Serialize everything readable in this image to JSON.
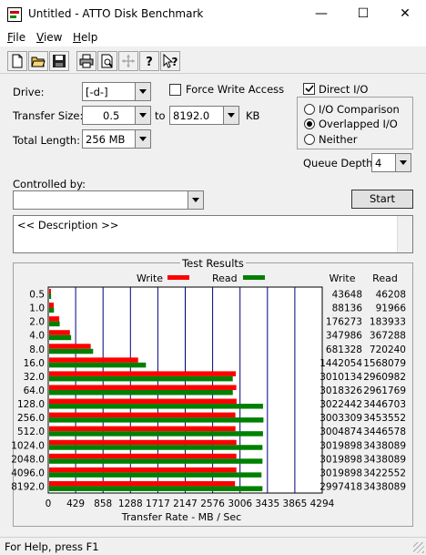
{
  "window": {
    "title": "Untitled - ATTO Disk Benchmark",
    "minimize_glyph": "—",
    "maximize_glyph": "☐",
    "close_glyph": "✕"
  },
  "menu": [
    {
      "label": "File",
      "accel": "F",
      "rest": "ile"
    },
    {
      "label": "View",
      "accel": "V",
      "rest": "iew"
    },
    {
      "label": "Help",
      "accel": "H",
      "rest": "elp"
    }
  ],
  "toolbar": {
    "icons": [
      "new-icon",
      "open-icon",
      "save-icon",
      "print-icon",
      "print-preview-icon",
      "move-icon",
      "help-icon",
      "context-help-icon"
    ]
  },
  "settings": {
    "drive_label": "Drive:",
    "drive_value": "[-d-]",
    "transfer_size_label": "Transfer Size:",
    "transfer_from": "0.5",
    "to_label": "to",
    "transfer_to": "8192.0",
    "kb_label": "KB",
    "total_length_label": "Total Length:",
    "total_length_value": "256 MB",
    "force_write_label": "Force Write Access",
    "force_write_checked": false,
    "direct_io_label": "Direct I/O",
    "direct_io_checked": true,
    "io_options": [
      "I/O Comparison",
      "Overlapped I/O",
      "Neither"
    ],
    "io_selected": "Overlapped I/O",
    "queue_depth_label": "Queue Depth:",
    "queue_depth_value": "4",
    "controlled_by_label": "Controlled by:",
    "controlled_by_value": "",
    "start_label": "Start"
  },
  "description": "<< Description >>",
  "results": {
    "group_title": "Test Results",
    "legend_write": "Write",
    "legend_read": "Read",
    "col_write": "Write",
    "col_read": "Read",
    "write_color": "#ff0000",
    "read_color": "#008000"
  },
  "chart_data": {
    "type": "bar",
    "orientation": "horizontal",
    "title": "Test Results",
    "xlabel": "Transfer Rate - MB / Sec",
    "xlim": [
      0,
      4294
    ],
    "xticks": [
      "0",
      "429",
      "858",
      "1288",
      "1717",
      "2147",
      "2576",
      "3006",
      "3435",
      "3865",
      "4294"
    ],
    "categories": [
      "0.5",
      "1.0",
      "2.0",
      "4.0",
      "8.0",
      "16.0",
      "32.0",
      "64.0",
      "128.0",
      "256.0",
      "512.0",
      "1024.0",
      "2048.0",
      "4096.0",
      "8192.0"
    ],
    "series": [
      {
        "name": "Write",
        "color": "#ff0000",
        "values": [
          43648,
          88136,
          176273,
          347986,
          681328,
          1442054,
          3010134,
          3018326,
          3022442,
          3003309,
          3004874,
          3019898,
          3019898,
          3019898,
          2997418
        ]
      },
      {
        "name": "Read",
        "color": "#008000",
        "values": [
          46208,
          91966,
          183933,
          367288,
          720240,
          1568079,
          2960982,
          2961769,
          3446703,
          3453552,
          3446578,
          3438089,
          3438089,
          3422552,
          3438089
        ]
      }
    ]
  },
  "status": "For Help, press F1"
}
